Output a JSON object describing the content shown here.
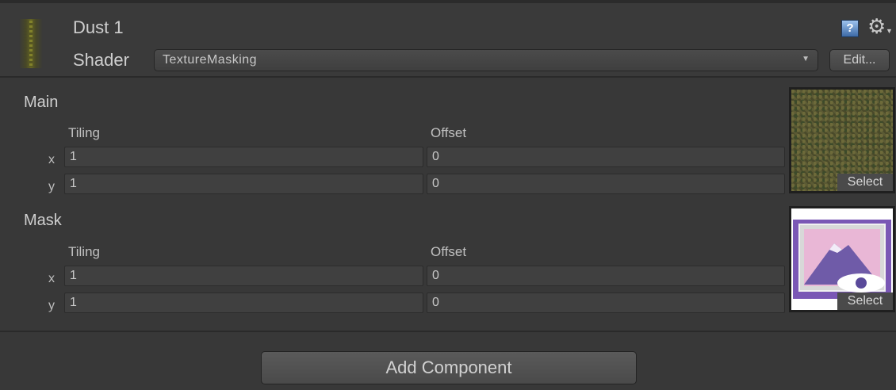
{
  "material": {
    "title": "Dust 1",
    "shader_label": "Shader",
    "shader_value": "TextureMasking",
    "edit_label": "Edit...",
    "help_glyph": "?",
    "icons": [
      "material-icon",
      "help-icon",
      "gear-icon"
    ]
  },
  "properties": [
    {
      "name": "Main",
      "tiling_label": "Tiling",
      "offset_label": "Offset",
      "x_label": "x",
      "y_label": "y",
      "tiling": {
        "x": "1",
        "y": "1"
      },
      "offset": {
        "x": "0",
        "y": "0"
      },
      "select_label": "Select"
    },
    {
      "name": "Mask",
      "tiling_label": "Tiling",
      "offset_label": "Offset",
      "x_label": "x",
      "y_label": "y",
      "tiling": {
        "x": "1",
        "y": "1"
      },
      "offset": {
        "x": "0",
        "y": "0"
      },
      "select_label": "Select"
    }
  ],
  "footer": {
    "add_component_label": "Add Component"
  },
  "colors": {
    "background": "#383838",
    "field": "#404040",
    "help_blue": "#3d6aa6"
  }
}
